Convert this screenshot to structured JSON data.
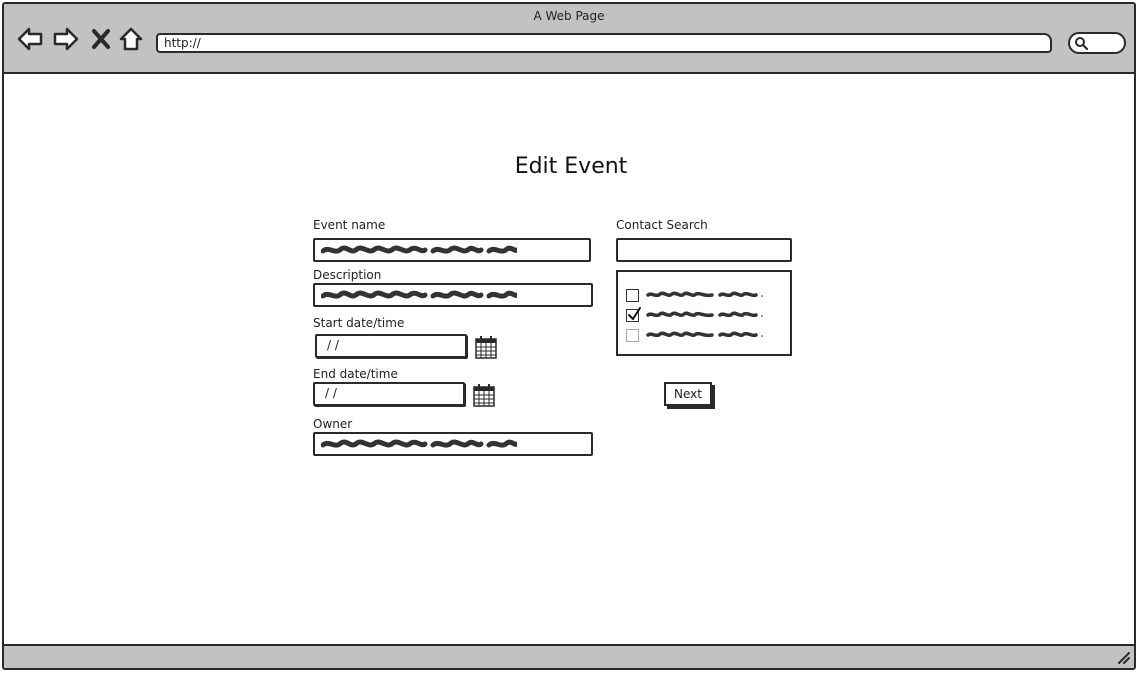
{
  "window": {
    "title": "A Web Page"
  },
  "toolbar": {
    "url": "http://",
    "icons": [
      "back-arrow-icon",
      "forward-arrow-icon",
      "close-x-icon",
      "home-icon",
      "search-icon"
    ]
  },
  "page": {
    "title": "Edit Event"
  },
  "form": {
    "event_name_label": "Event name",
    "description_label": "Description",
    "start_label": "Start date/time",
    "start_value": "/ /",
    "end_label": "End date/time",
    "end_value": "/ /",
    "owner_label": "Owner",
    "contact_search_label": "Contact Search",
    "contacts": [
      {
        "checked": false,
        "enabled": true
      },
      {
        "checked": true,
        "enabled": true
      },
      {
        "checked": false,
        "enabled": false
      }
    ],
    "next_label": "Next"
  },
  "colors": {
    "chrome": "#c2c2c2",
    "ink": "#2a2a2a",
    "background": "#ffffff"
  }
}
